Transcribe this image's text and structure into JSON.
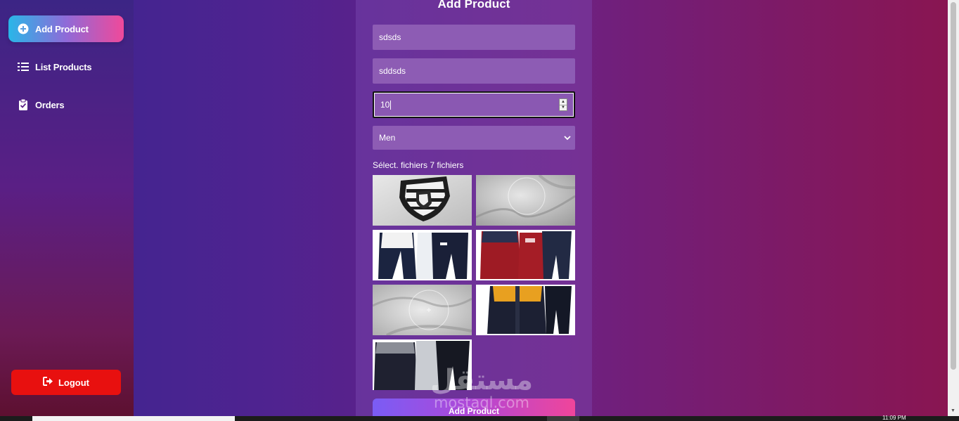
{
  "sidebar": {
    "items": [
      {
        "label": "Add Product",
        "icon": "plus-circle-icon",
        "active": true
      },
      {
        "label": "List Products",
        "icon": "list-icon",
        "active": false
      },
      {
        "label": "Orders",
        "icon": "clipboard-check-icon",
        "active": false
      }
    ],
    "logout_label": "Logout",
    "logout_icon": "sign-out-icon"
  },
  "form": {
    "title": "Add Product",
    "name_value": "sdsds",
    "description_value": "sddsds",
    "price_value": "10",
    "category_value": "Men",
    "files_label": "Sélect. fichiers 7 fichiers",
    "images": [
      {
        "name": "crest-closeup"
      },
      {
        "name": "grey-fabric-closeup"
      },
      {
        "name": "navy-white-tracksuit"
      },
      {
        "name": "red-navy-tracksuit"
      },
      {
        "name": "grey-hood-closeup"
      },
      {
        "name": "black-yellow-tracksuit"
      },
      {
        "name": "grey-black-tracksuit"
      }
    ],
    "submit_label": "Add Product"
  },
  "watermark": {
    "arabic": "مستقل",
    "latin": "mostaql.com"
  },
  "taskbar": {
    "clock": "11:09 PM"
  },
  "colors": {
    "active_gradient": [
      "#29b6e8",
      "#f0499a"
    ],
    "logout": "#e8100f",
    "field_bg": "#8d5cb4",
    "submit_gradient": [
      "#7a5cf5",
      "#f0459a"
    ]
  }
}
